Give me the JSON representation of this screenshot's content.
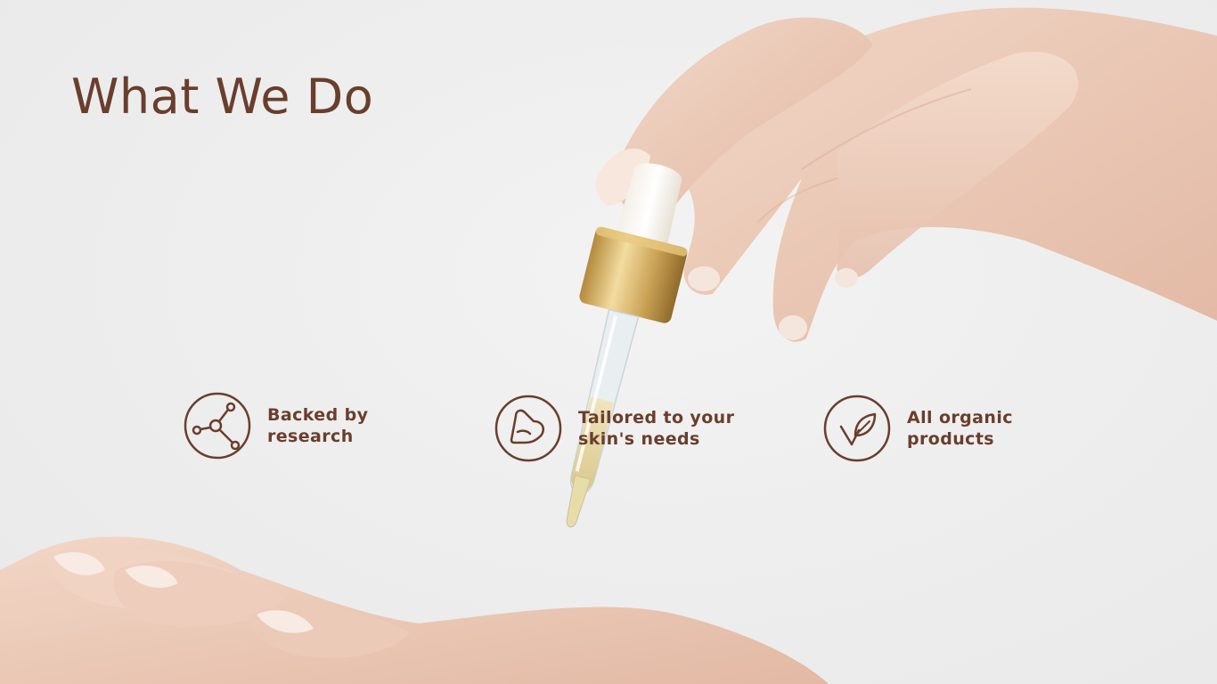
{
  "slide": {
    "title": "What We Do"
  },
  "features": [
    {
      "icon": "molecule-icon",
      "line1": "Backed by",
      "line2": "research"
    },
    {
      "icon": "heart-drop-icon",
      "line1": "Tailored to your",
      "line2": "skin's needs"
    },
    {
      "icon": "leaf-check-icon",
      "line1": "All organic",
      "line2": "products"
    }
  ],
  "colors": {
    "accent": "#6a3e2c",
    "background": "#eeeeee"
  }
}
